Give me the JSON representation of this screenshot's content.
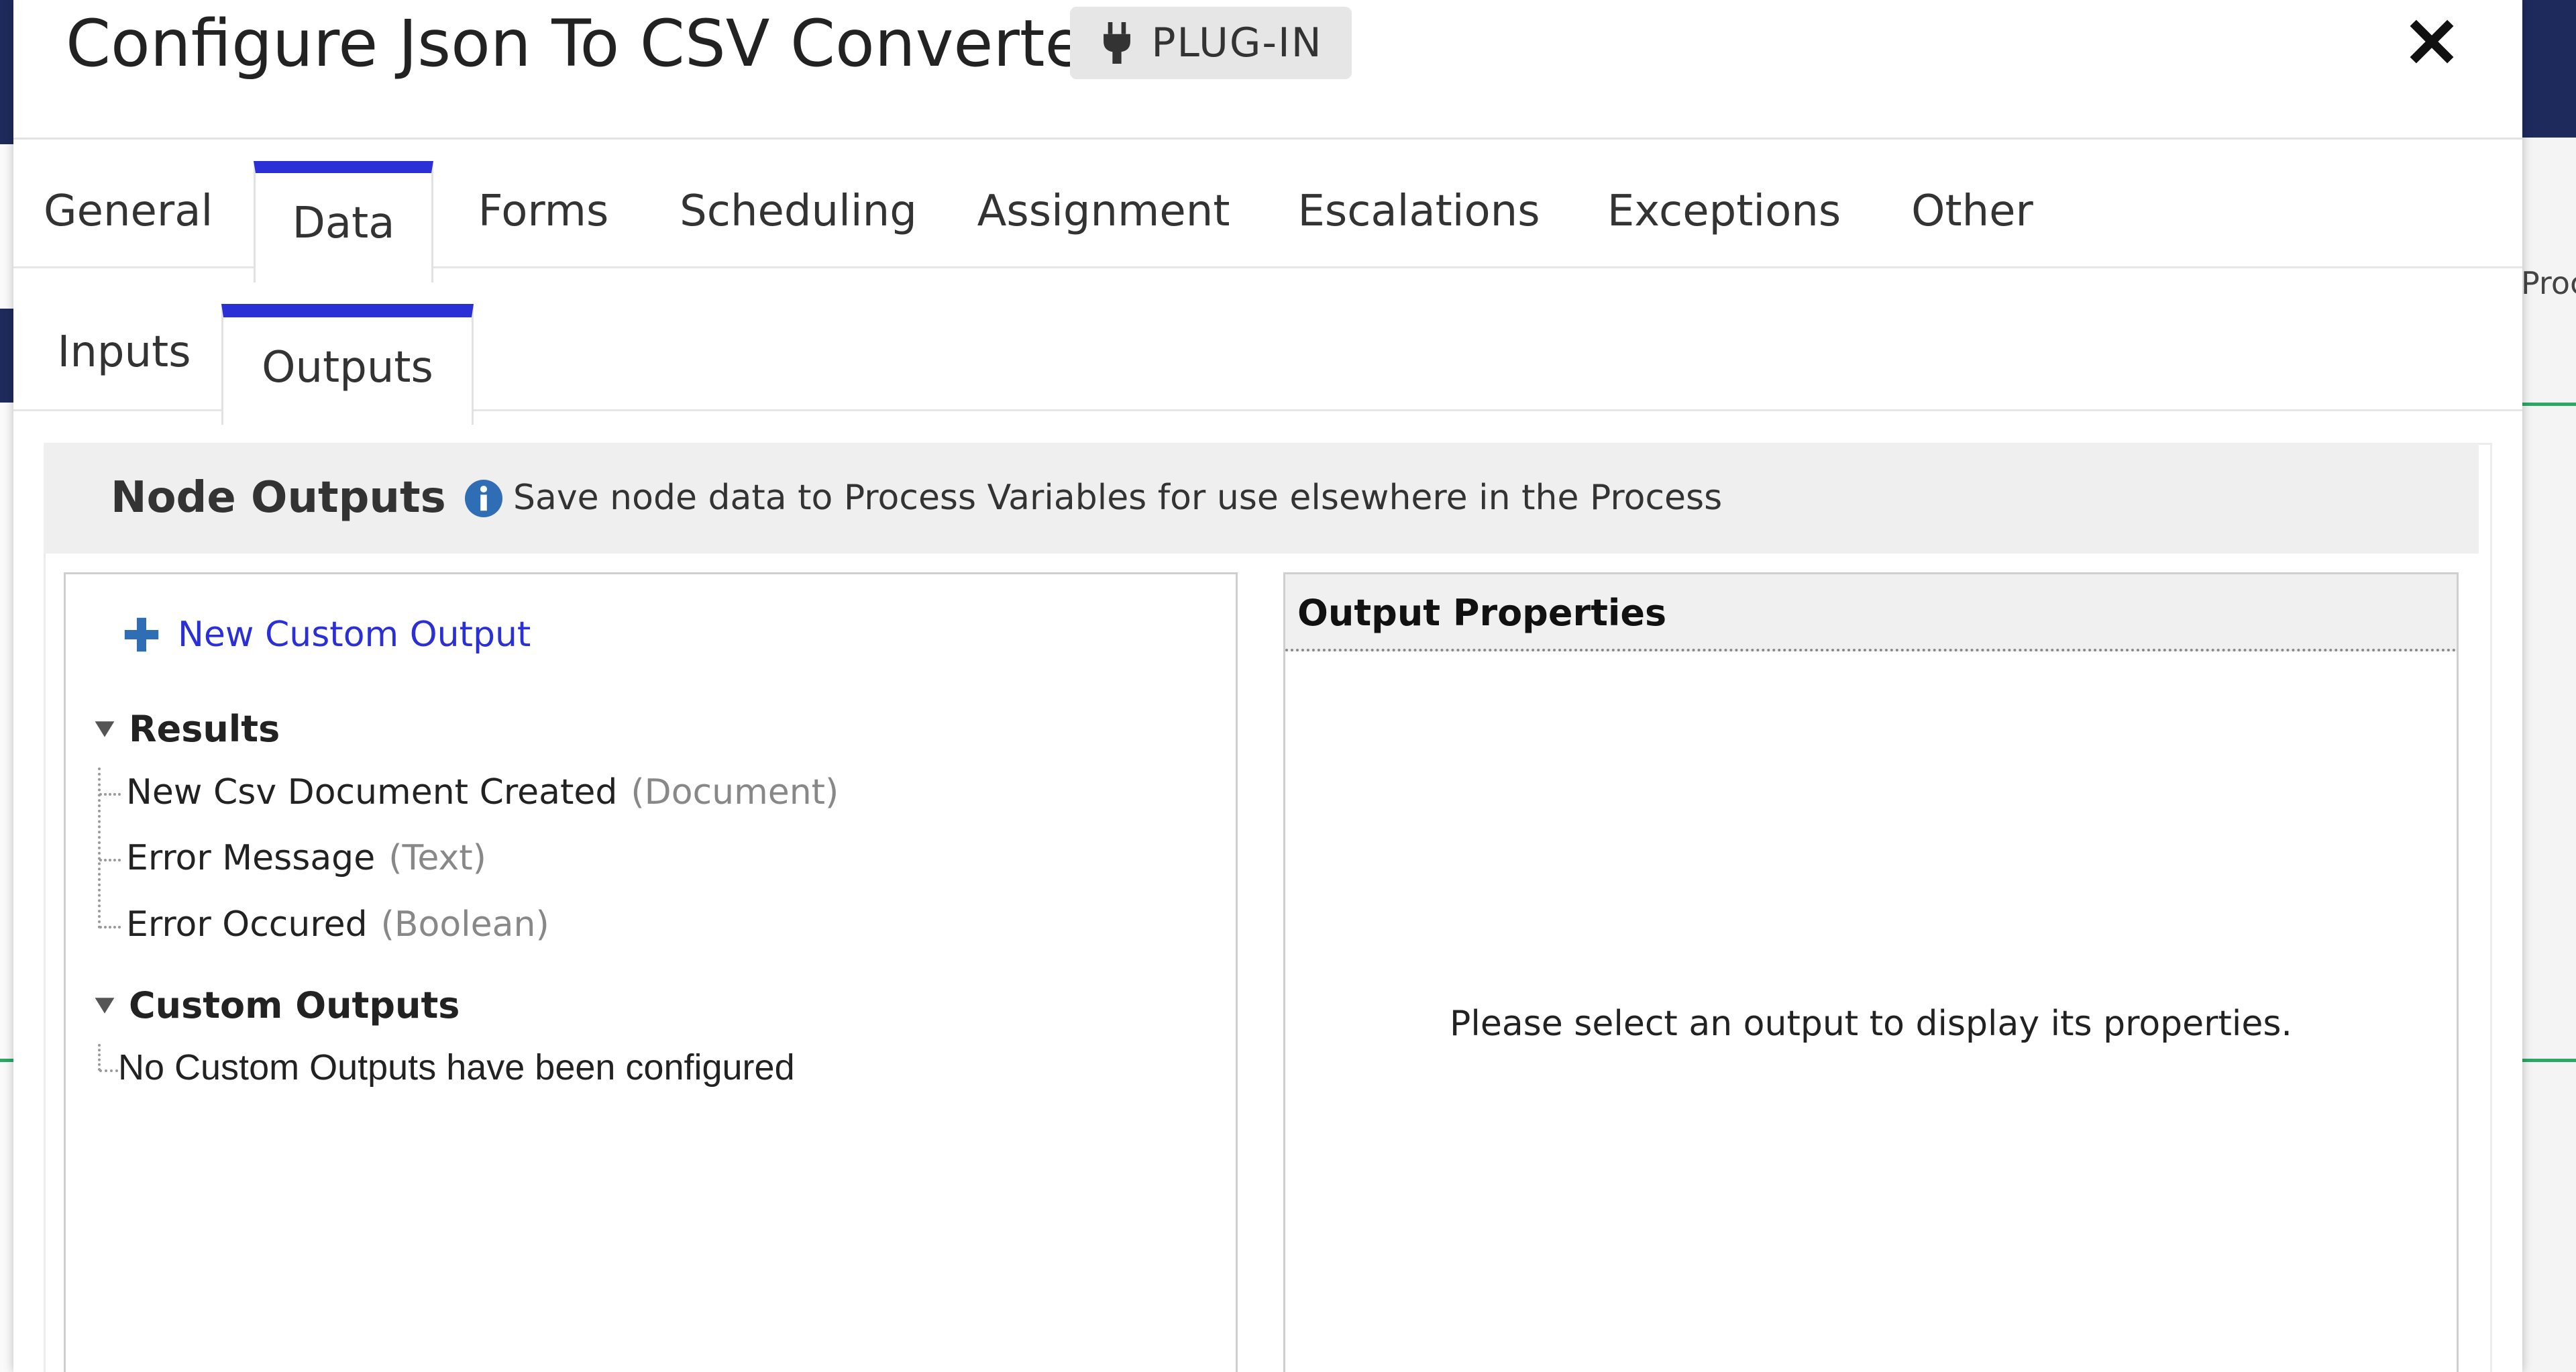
{
  "background": {
    "right_peek_text": "Proc"
  },
  "modal": {
    "title": "Configure Json To CSV Converter",
    "badge": {
      "icon": "plug-icon",
      "label": "PLUG-IN"
    },
    "close_icon": "close-icon"
  },
  "main_tabs": [
    {
      "label": "General",
      "active": false
    },
    {
      "label": "Data",
      "active": true
    },
    {
      "label": "Forms",
      "active": false
    },
    {
      "label": "Scheduling",
      "active": false
    },
    {
      "label": "Assignment",
      "active": false
    },
    {
      "label": "Escalations",
      "active": false
    },
    {
      "label": "Exceptions",
      "active": false
    },
    {
      "label": "Other",
      "active": false
    }
  ],
  "sub_tabs": [
    {
      "label": "Inputs",
      "active": false
    },
    {
      "label": "Outputs",
      "active": true
    }
  ],
  "node_outputs": {
    "title": "Node Outputs",
    "info_icon": "info-icon",
    "description": "Save node data to Process Variables for use elsewhere in the Process"
  },
  "tree": {
    "new_output_label": "New Custom Output",
    "new_output_icon": "plus-icon",
    "results": {
      "label": "Results",
      "items": [
        {
          "name": "New Csv Document Created",
          "type": "(Document)"
        },
        {
          "name": "Error Message",
          "type": "(Text)"
        },
        {
          "name": "Error Occured",
          "type": "(Boolean)"
        }
      ]
    },
    "custom_outputs": {
      "label": "Custom Outputs",
      "empty_message": "No Custom Outputs have been configured"
    }
  },
  "properties": {
    "title": "Output Properties",
    "empty_message": "Please select an output to display its properties."
  },
  "colors": {
    "accent": "#2b2fd6",
    "navy": "#1e2a5c",
    "info_blue": "#2f6db5",
    "green_line": "#2aa864"
  }
}
